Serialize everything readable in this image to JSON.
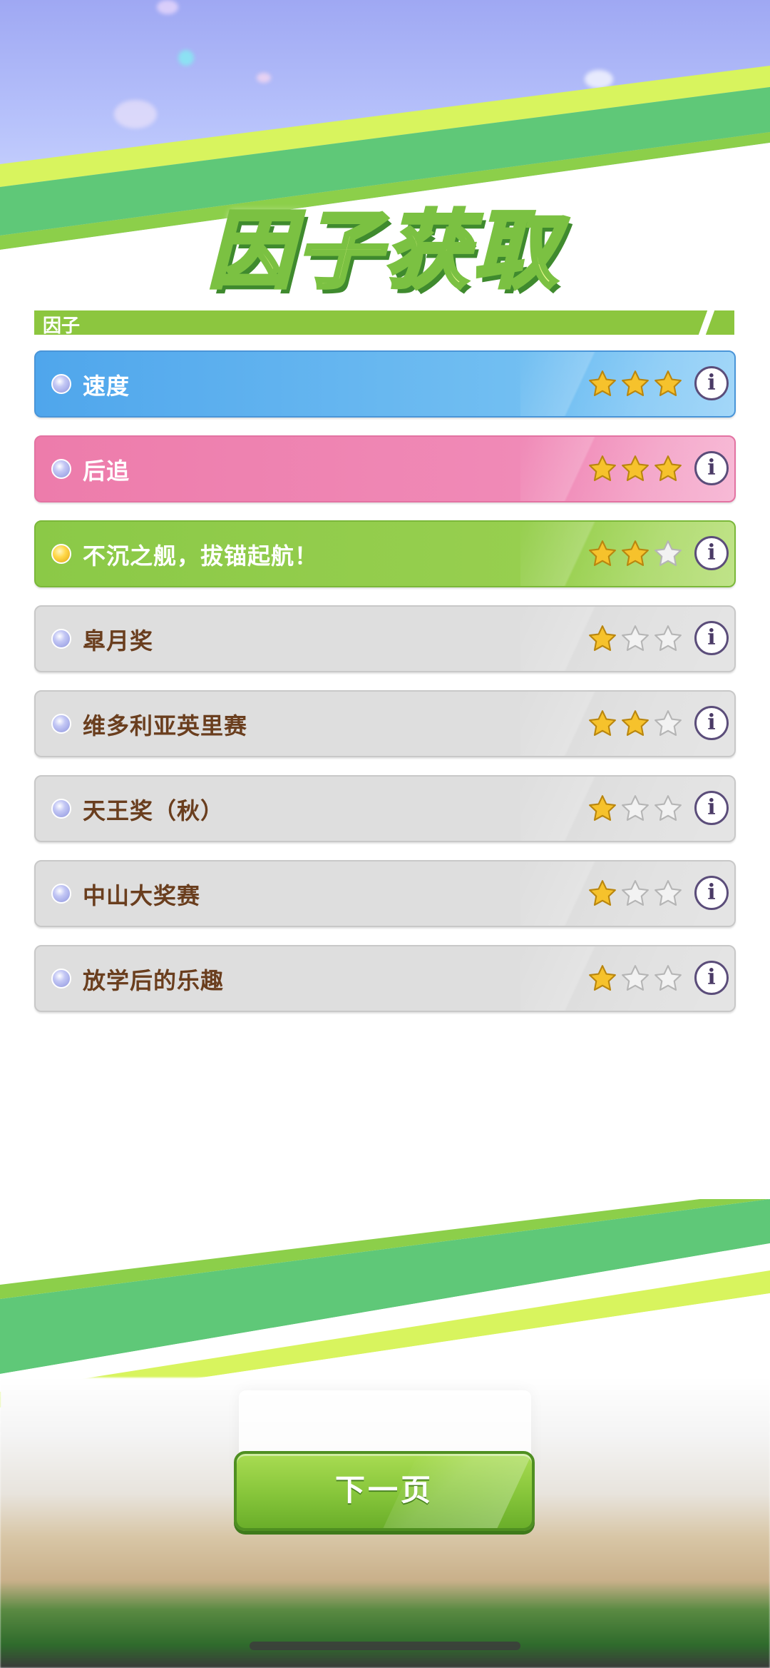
{
  "header": {
    "title": "因子获取"
  },
  "section": {
    "label": "因子"
  },
  "factors": [
    {
      "name": "速度",
      "stars": 3,
      "color": "blue",
      "bullet": "blue-orb"
    },
    {
      "name": "后追",
      "stars": 3,
      "color": "pink",
      "bullet": "blue-orb"
    },
    {
      "name": "不沉之舰，拔锚起航！",
      "stars": 2,
      "color": "green",
      "bullet": "gold-orb"
    },
    {
      "name": "皐月奖",
      "stars": 1,
      "color": "gray",
      "bullet": "blue-orb"
    },
    {
      "name": "维多利亚英里赛",
      "stars": 2,
      "color": "gray",
      "bullet": "blue-orb"
    },
    {
      "name": "天王奖（秋）",
      "stars": 1,
      "color": "gray",
      "bullet": "blue-orb"
    },
    {
      "name": "中山大奖赛",
      "stars": 1,
      "color": "gray",
      "bullet": "blue-orb"
    },
    {
      "name": "放学后的乐趣",
      "stars": 1,
      "color": "gray",
      "bullet": "blue-orb"
    }
  ],
  "info_label": "i",
  "max_stars": 3,
  "footer": {
    "next_label": "下一页"
  },
  "colors": {
    "accent_green": "#8cc63f",
    "blue_row": "#5aaeee",
    "pink_row": "#ee82b0",
    "gray_row": "#dedede",
    "star_gold": "#f6c22c",
    "gray_text": "#6a3e1e"
  }
}
